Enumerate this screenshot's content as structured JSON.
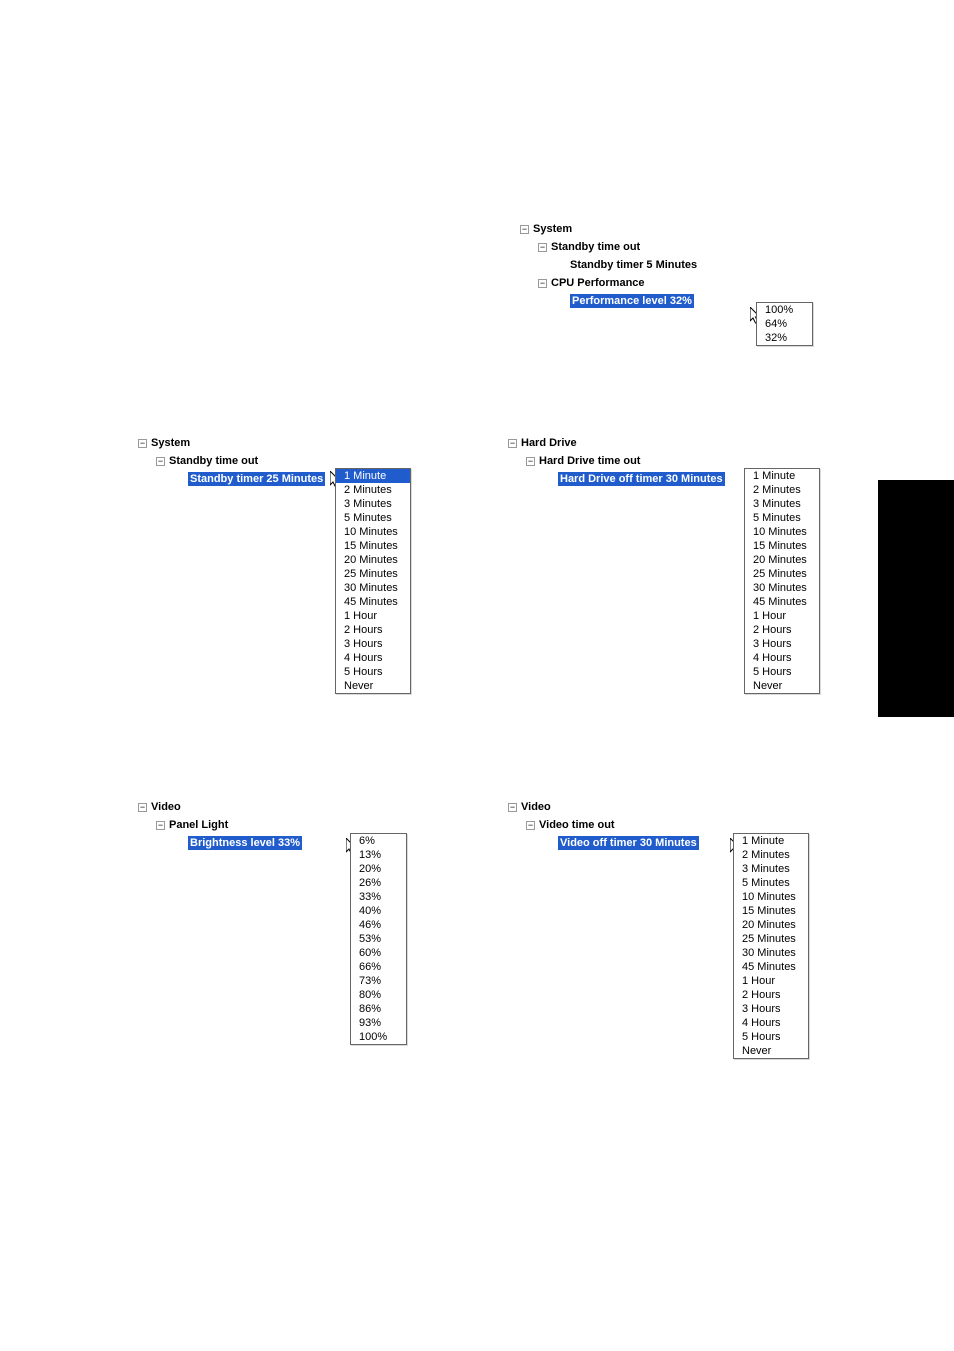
{
  "top": {
    "root": "System",
    "n1": "Standby time out",
    "n1_leaf": "Standby timer 5 Minutes",
    "n2": "CPU Performance",
    "n2_leaf": "Performance level 32%",
    "menu": [
      "100%",
      "64%",
      "32%"
    ]
  },
  "midL": {
    "root": "System",
    "n1": "Standby time out",
    "leaf": "Standby timer 25 Minutes",
    "menu": [
      "1 Minute",
      "2 Minutes",
      "3 Minutes",
      "5 Minutes",
      "10 Minutes",
      "15 Minutes",
      "20 Minutes",
      "25 Minutes",
      "30 Minutes",
      "45 Minutes",
      "1 Hour",
      "2 Hours",
      "3 Hours",
      "4 Hours",
      "5 Hours",
      "Never"
    ]
  },
  "midR": {
    "root": "Hard Drive",
    "n1": "Hard Drive time out",
    "leaf": "Hard Drive off timer 30 Minutes",
    "menu": [
      "1 Minute",
      "2 Minutes",
      "3 Minutes",
      "5 Minutes",
      "10 Minutes",
      "15 Minutes",
      "20 Minutes",
      "25 Minutes",
      "30 Minutes",
      "45 Minutes",
      "1 Hour",
      "2 Hours",
      "3 Hours",
      "4 Hours",
      "5 Hours",
      "Never"
    ]
  },
  "botL": {
    "root": "Video",
    "n1": "Panel Light",
    "leaf": "Brightness level 33%",
    "menu": [
      "6%",
      "13%",
      "20%",
      "26%",
      "33%",
      "40%",
      "46%",
      "53%",
      "60%",
      "66%",
      "73%",
      "80%",
      "86%",
      "93%",
      "100%"
    ]
  },
  "botR": {
    "root": "Video",
    "n1": "Video time out",
    "leaf": "Video off timer 30 Minutes",
    "menu": [
      "1 Minute",
      "2 Minutes",
      "3 Minutes",
      "5 Minutes",
      "10 Minutes",
      "15 Minutes",
      "20 Minutes",
      "25 Minutes",
      "30 Minutes",
      "45 Minutes",
      "1 Hour",
      "2 Hours",
      "3 Hours",
      "4 Hours",
      "5 Hours",
      "Never"
    ]
  },
  "toggle_minus": "−"
}
